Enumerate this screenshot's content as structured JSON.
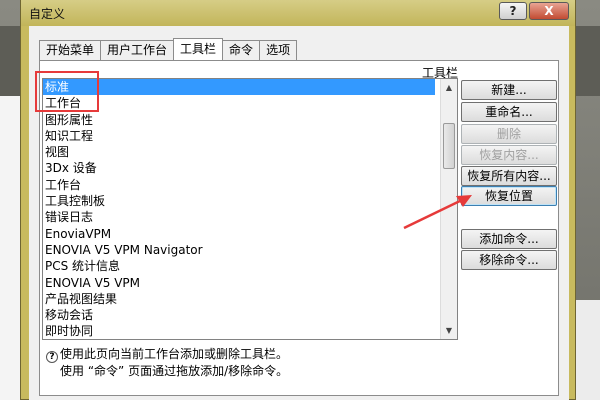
{
  "window": {
    "title": "自定义",
    "help_label": "?",
    "close_label": "X"
  },
  "tabs": [
    {
      "label": "开始菜单",
      "active": false
    },
    {
      "label": "用户工作台",
      "active": false
    },
    {
      "label": "工具栏",
      "active": true
    },
    {
      "label": "命令",
      "active": false
    },
    {
      "label": "选项",
      "active": false
    }
  ],
  "toolbars": {
    "section_label": "工具栏",
    "selected_index": 0,
    "items": [
      "标准",
      "工作台",
      "图形属性",
      "知识工程",
      "视图",
      "3Dx 设备",
      "工作台",
      "工具控制板",
      "错误日志",
      "EnoviaVPM",
      "ENOVIA V5 VPM Navigator",
      "PCS 统计信息",
      "ENOVIA V5 VPM",
      "产品视图结果",
      "移动会话",
      "即时协同"
    ]
  },
  "buttons": {
    "new": "新建...",
    "rename": "重命名...",
    "delete": "删除",
    "restore_content": "恢复内容...",
    "restore_all": "恢复所有内容...",
    "restore_position": "恢复位置",
    "add_command": "添加命令...",
    "remove_command": "移除命令..."
  },
  "info": {
    "line1": "使用此页向当前工作台添加或删除工具栏。",
    "line2": "使用 “命令” 页面通过拖放添加/移除命令。"
  },
  "colors": {
    "selection": "#3399ff",
    "highlight_box": "#e63a3a",
    "title_bar": "#c8ba5e"
  },
  "icons": {
    "info": "info-icon",
    "scroll_up": "chevron-up-icon",
    "scroll_down": "chevron-down-icon",
    "annotation": "red-arrow-icon"
  }
}
